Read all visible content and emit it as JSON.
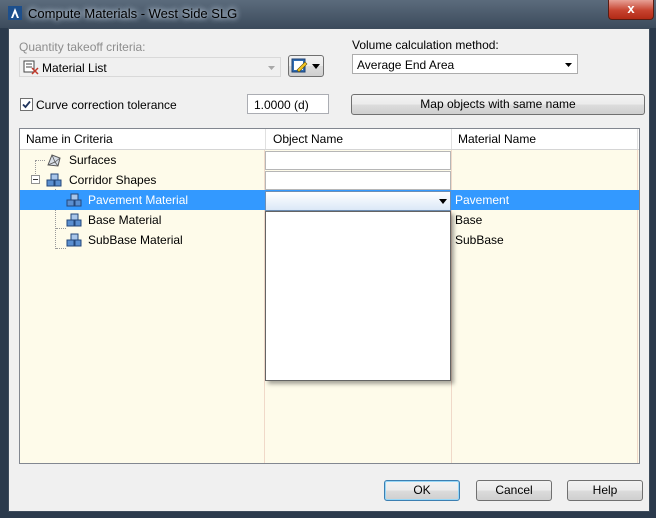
{
  "window": {
    "title": "Compute Materials - West Side SLG",
    "close_glyph": "x"
  },
  "criteria": {
    "label": "Quantity takeoff criteria:",
    "value": "Material List"
  },
  "volume": {
    "label": "Volume calculation method:",
    "value": "Average End Area"
  },
  "curve": {
    "label": "Curve correction tolerance",
    "checked": true,
    "value": "1.0000 (d)"
  },
  "map_button": "Map objects with same name",
  "grid": {
    "columns": [
      "Name in Criteria",
      "Object Name",
      "Material Name"
    ],
    "rows": [
      {
        "name": "Surfaces",
        "object": "",
        "material": ""
      },
      {
        "name": "Corridor Shapes",
        "object": "",
        "material": ""
      },
      {
        "name": "Pavement Material",
        "object": "",
        "material": "Pavement",
        "selected": true
      },
      {
        "name": "Base Material",
        "object": "",
        "material": "Base"
      },
      {
        "name": "SubBase Material",
        "object": "",
        "material": "SubBase"
      }
    ]
  },
  "buttons": {
    "ok": "OK",
    "cancel": "Cancel",
    "help": "Help"
  },
  "colors": {
    "selection": "#3399ff",
    "grid_body": "#fefbea",
    "title_close": "#c7432f"
  }
}
